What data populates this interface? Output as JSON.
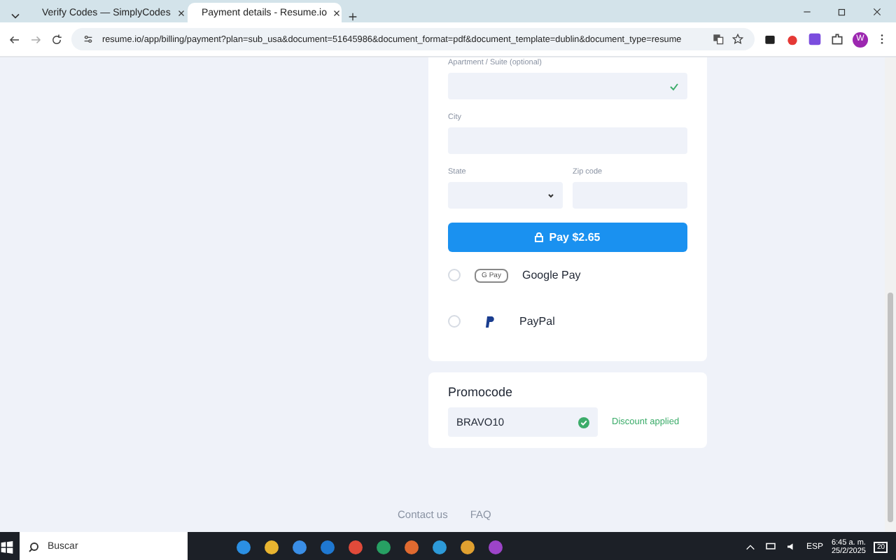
{
  "browser": {
    "tabs": [
      {
        "title": "Verify Codes — SimplyCodes",
        "selected": false
      },
      {
        "title": "Payment details - Resume.io",
        "selected": true
      }
    ],
    "url": "resume.io/app/billing/payment?plan=sub_usa&document=51645986&document_format=pdf&document_template=dublin&document_type=resume",
    "profile": "W"
  },
  "form": {
    "fields": [
      {
        "label": "Apartment / Suite (optional)",
        "valid": true,
        "kind": "text"
      },
      {
        "label": "City",
        "valid": false,
        "kind": "text"
      }
    ],
    "row": [
      {
        "label": "State",
        "valid": false,
        "kind": "select"
      },
      {
        "label": "Zip code",
        "valid": false,
        "kind": "text"
      }
    ],
    "pay_button": "Pay $2.65",
    "methods": [
      {
        "name": "Google Pay",
        "badge": "G Pay",
        "kind": "gpay",
        "selected": false
      },
      {
        "name": "PayPal",
        "kind": "paypal",
        "selected": false
      }
    ]
  },
  "promo": {
    "title": "Promocode",
    "value": "BRAVO10",
    "status": "Discount applied"
  },
  "footer": {
    "links": [
      "Contact us",
      "FAQ"
    ]
  },
  "taskbar": {
    "search": "Buscar",
    "language": "ESP",
    "time": "6:45 a. m.",
    "date": "25/2/2025",
    "notifications": "20"
  }
}
